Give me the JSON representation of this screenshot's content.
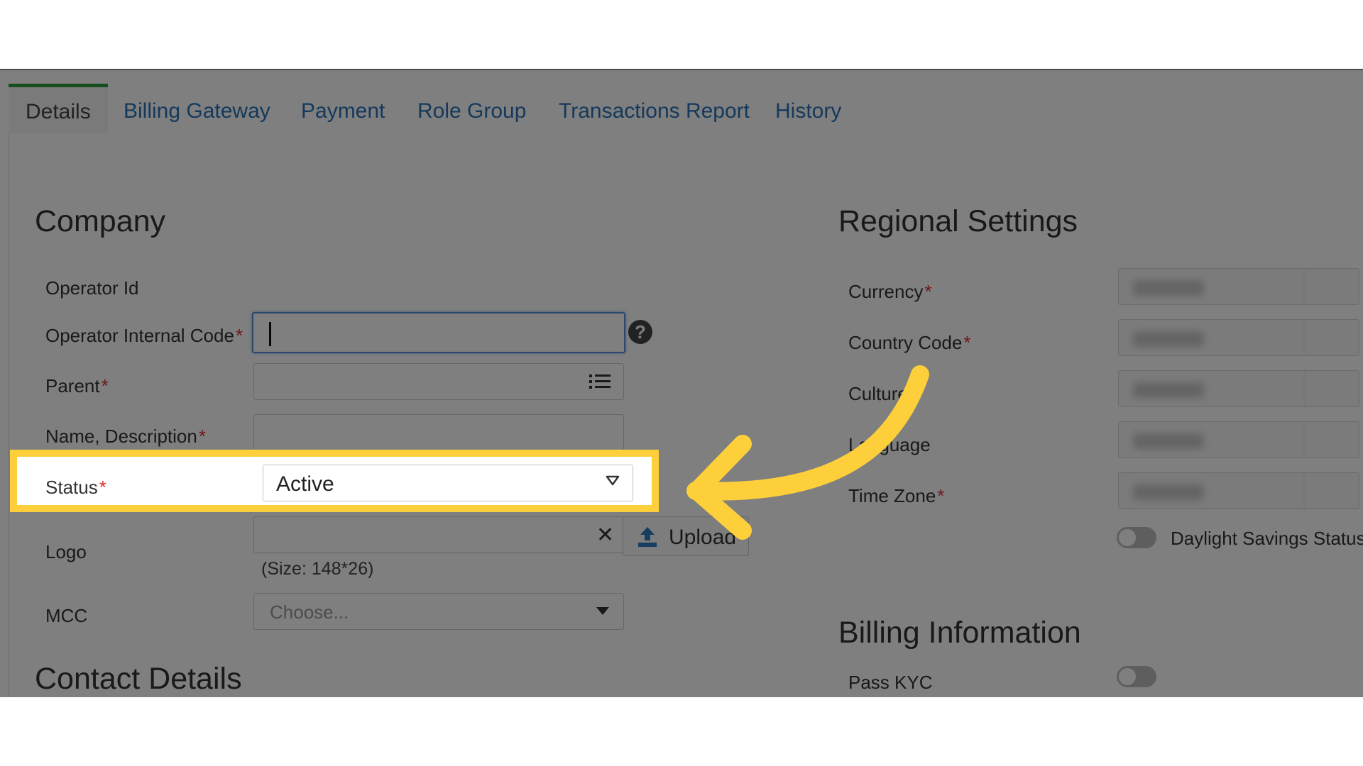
{
  "tabs": [
    {
      "label": "Details"
    },
    {
      "label": "Billing Gateway"
    },
    {
      "label": "Payment"
    },
    {
      "label": "Role Group"
    },
    {
      "label": "Transactions Report"
    },
    {
      "label": "History"
    }
  ],
  "company": {
    "title": "Company",
    "operator_id_label": "Operator Id",
    "operator_internal_code_label": "Operator Internal Code",
    "parent_label": "Parent",
    "name_description_label": "Name, Description",
    "status_label": "Status",
    "status_value": "Active",
    "logo_label": "Logo",
    "upload_label": "Upload",
    "logo_hint": "(Size: 148*26)",
    "mcc_label": "MCC",
    "mcc_placeholder": "Choose...",
    "required_mark": "*"
  },
  "contact": {
    "title": "Contact Details"
  },
  "regional": {
    "title": "Regional Settings",
    "currency_label": "Currency",
    "country_code_label": "Country Code",
    "culture_label": "Culture",
    "language_label": "Language",
    "time_zone_label": "Time Zone",
    "daylight_label": "Daylight Savings Status"
  },
  "billing": {
    "title": "Billing Information",
    "pass_kyc_label": "Pass KYC"
  },
  "icons": {
    "help": "question-circle-icon",
    "list": "list-icon",
    "clear": "close-icon",
    "upload": "upload-icon",
    "select_arrow": "triangle-down-icon",
    "mcc_arrow": "caret-down-icon",
    "pointer": "curved-arrow-icon"
  },
  "colors": {
    "highlight": "#fdd03b",
    "link": "#2a72b8",
    "active_tab_border": "#2e9c3c",
    "required": "#dd3333"
  }
}
